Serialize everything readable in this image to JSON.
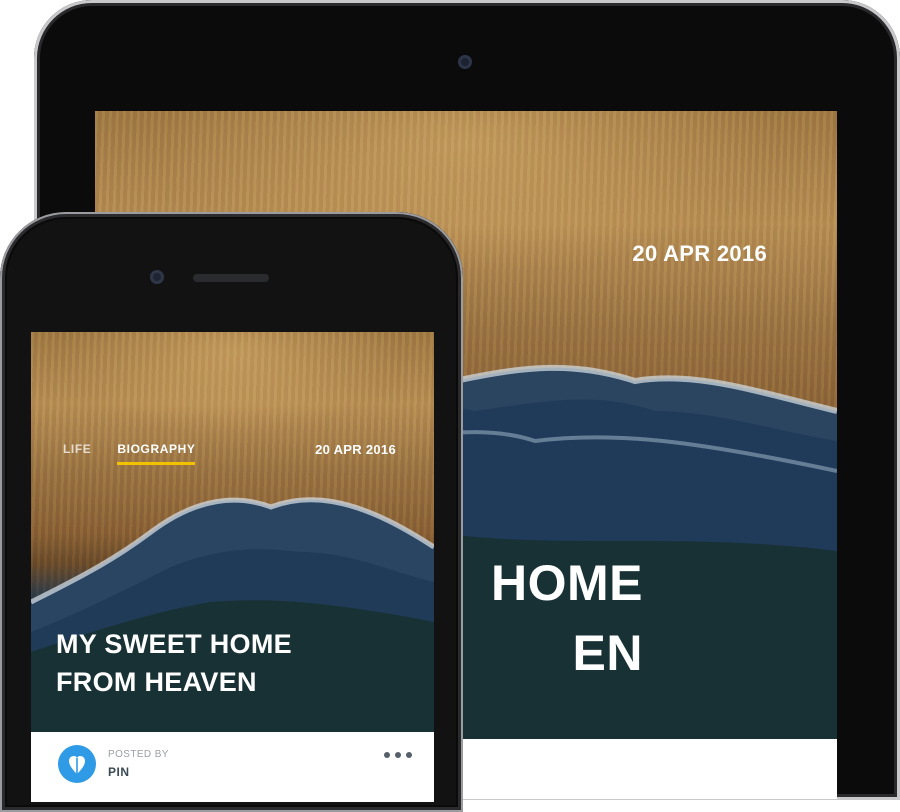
{
  "tablet": {
    "date": "20 APR 2016",
    "title_lines": [
      "HOME",
      "EN"
    ]
  },
  "phone": {
    "tabs": [
      "LIFE",
      "BIOGRAPHY"
    ],
    "active_tab": "BIOGRAPHY",
    "date": "20 APR 2016",
    "title_lines": [
      "MY SWEET HOME",
      "FROM HEAVEN"
    ],
    "posted_by_label": "POSTED BY",
    "author": "PIN",
    "more_icon": "more-horizontal-icon",
    "avatar_icon": "heart-icon"
  },
  "colors": {
    "tab_underline": "#f2c200",
    "avatar_bg": "#2f9ae6"
  }
}
